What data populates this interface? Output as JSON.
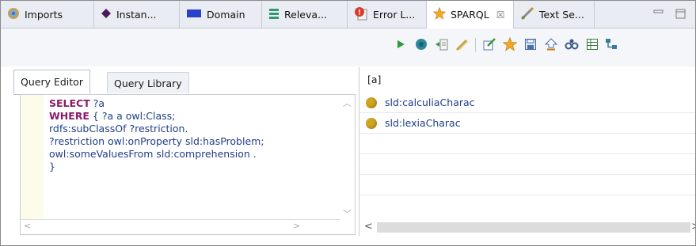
{
  "tabs": [
    {
      "label": "Imports",
      "icon": "imports-icon"
    },
    {
      "label": "Instan...",
      "icon": "instance-diamond-icon"
    },
    {
      "label": "Domain",
      "icon": "domain-icon"
    },
    {
      "label": "Releva...",
      "icon": "relevance-icon"
    },
    {
      "label": "Error L...",
      "icon": "error-log-icon"
    },
    {
      "label": "SPARQL",
      "icon": "sparql-star-icon",
      "active": true,
      "close": "☒"
    },
    {
      "label": "Text Se...",
      "icon": "text-search-icon"
    }
  ],
  "toolbar_icons": [
    "run-query-icon",
    "stop-query-icon",
    "export-results-icon",
    "clear-icon",
    "edit-query-icon",
    "bookmark-star-icon",
    "save-icon",
    "upload-icon",
    "graph-view-icon",
    "table-view-icon",
    "tree-view-icon"
  ],
  "editor_tabs": {
    "query_editor": "Query Editor",
    "query_library": "Query Library"
  },
  "query": {
    "line1_kw": "SELECT",
    "line1_rest": " ?a",
    "line2_kw": "WHERE",
    "line2_rest": " { ?a a owl:Class;",
    "line3": "rdfs:subClassOf ?restriction.",
    "line4": "?restriction owl:onProperty sld:hasProblem;",
    "line5": "owl:someValuesFrom sld:comprehension .",
    "line6": "}"
  },
  "results": {
    "column": "[a]",
    "rows": [
      "sld:calculiaCharac",
      "sld:lexiaCharac"
    ]
  },
  "colors": {
    "accent_star": "#f5a623",
    "individual_dot": "#d0a520",
    "keyword": "#8b1a6b"
  }
}
